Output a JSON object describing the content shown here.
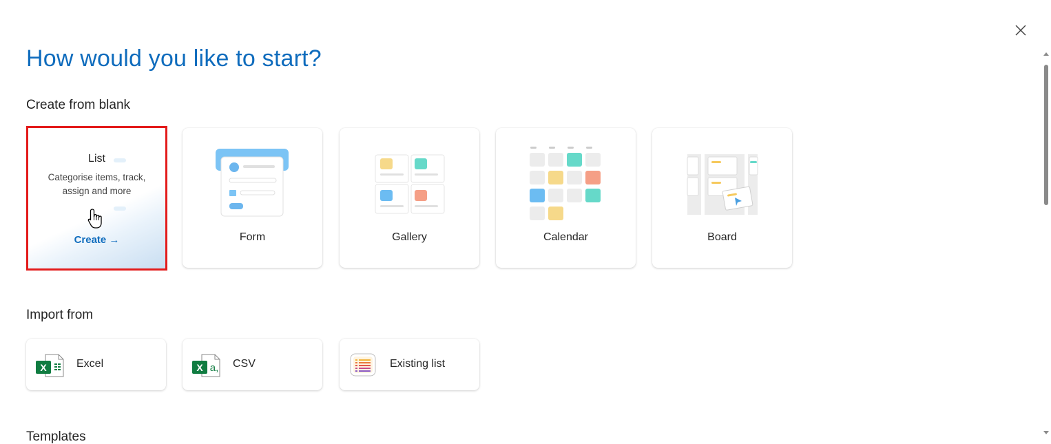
{
  "dialog": {
    "title": "How would you like to start?",
    "close_icon": "close-icon"
  },
  "create_from_blank": {
    "label": "Create from blank",
    "list": {
      "title": "List",
      "description": "Categorise items, track, assign and more",
      "action": "Create →"
    },
    "cards": [
      {
        "label": "Form",
        "icon": "form-illustration-icon"
      },
      {
        "label": "Gallery",
        "icon": "gallery-illustration-icon"
      },
      {
        "label": "Calendar",
        "icon": "calendar-illustration-icon"
      },
      {
        "label": "Board",
        "icon": "board-illustration-icon"
      }
    ]
  },
  "import_from": {
    "label": "Import from",
    "items": [
      {
        "label": "Excel",
        "icon": "excel-icon"
      },
      {
        "label": "CSV",
        "icon": "csv-icon"
      },
      {
        "label": "Existing list",
        "icon": "existing-list-icon"
      }
    ]
  },
  "templates": {
    "label": "Templates"
  },
  "colors": {
    "accent": "#0f6cbd",
    "selection_outline": "#e31b1b",
    "excel_green": "#107c41"
  }
}
